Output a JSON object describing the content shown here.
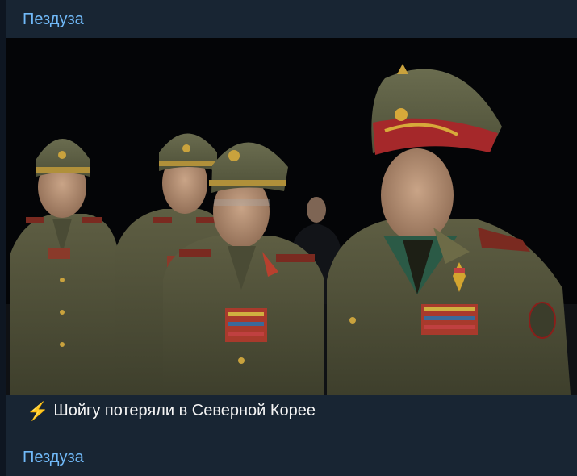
{
  "post": {
    "channel_name": "Пездуза",
    "caption_icon": "lightning-icon",
    "caption_text": "Шойгу потеряли в Северной Корее",
    "footer_channel": "Пездуза"
  },
  "colors": {
    "background": "#0e1621",
    "bubble": "#182533",
    "link": "#71baf9",
    "caption_text": "#f5f5f5",
    "lightning": "#f6c22a"
  }
}
